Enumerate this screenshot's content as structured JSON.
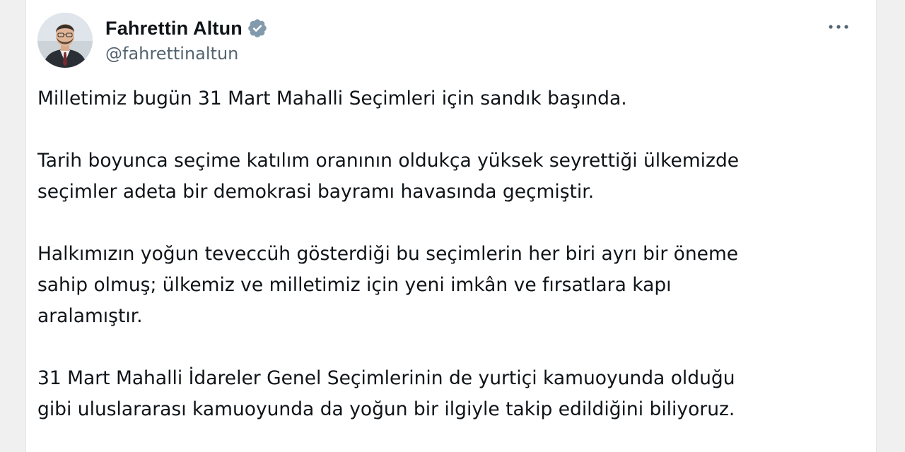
{
  "tweet": {
    "author": {
      "display_name": "Fahrettin Altun",
      "handle": "@fahrettinaltun",
      "verified": true
    },
    "menu_icon": "more-horizontal-icon",
    "paragraphs": [
      [
        "Milletimiz bugün 31 Mart Mahalli Seçimleri için sandık başında."
      ],
      [
        "Tarih boyunca seçime katılım oranının oldukça yüksek seyrettiği ülkemizde",
        "seçimler adeta bir demokrasi bayramı havasında geçmiştir."
      ],
      [
        "Halkımızın yoğun teveccüh gösterdiği bu seçimlerin her biri ayrı bir öneme",
        "sahip olmuş; ülkemiz ve milletimiz için yeni imkân ve fırsatlara kapı",
        "aralamıştır."
      ],
      [
        "31 Mart Mahalli İdareler Genel Seçimlerinin de yurtiçi kamuoyunda olduğu",
        "gibi uluslararası kamuoyunda da yoğun bir ilgiyle takip edildiğini biliyoruz."
      ]
    ]
  },
  "colors": {
    "text": "#0f1419",
    "secondary": "#536471",
    "verified_badge": "#829aab"
  }
}
